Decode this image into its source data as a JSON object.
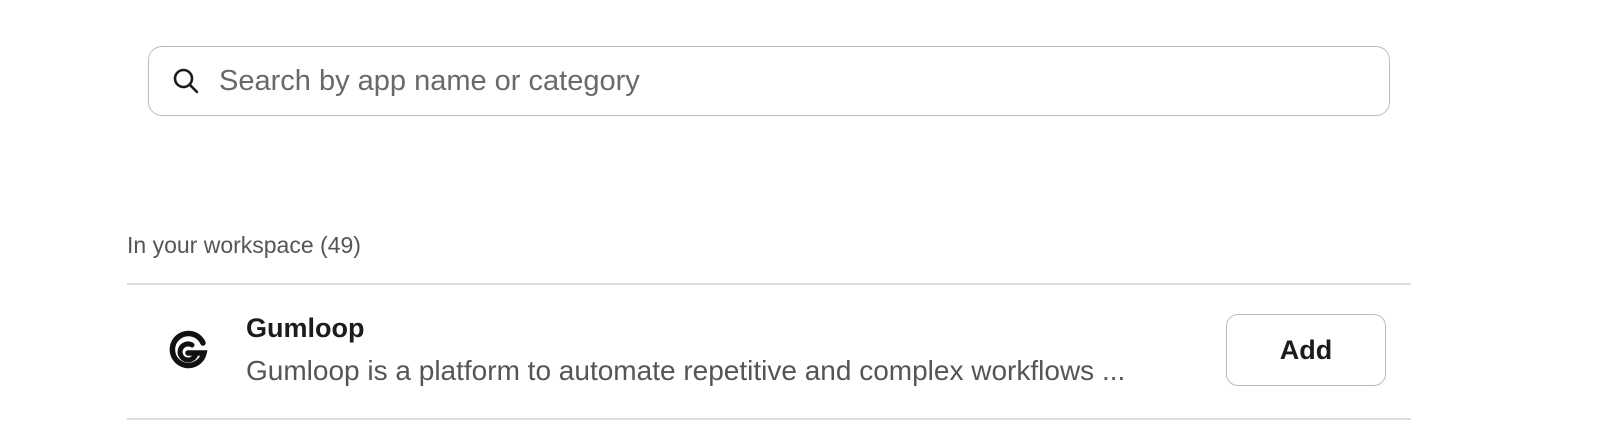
{
  "search": {
    "placeholder": "Search by app name or category",
    "value": ""
  },
  "section": {
    "header": "In your workspace (49)"
  },
  "apps": [
    {
      "name": "Gumloop",
      "description": "Gumloop is a platform to automate repetitive and complex workflows ...",
      "logo_icon": "gumloop-logo-icon",
      "action_label": "Add"
    }
  ],
  "colors": {
    "border": "#bdbdbd",
    "divider": "#dddddd",
    "muted_text": "#555555",
    "primary_text": "#1d1c1d"
  }
}
